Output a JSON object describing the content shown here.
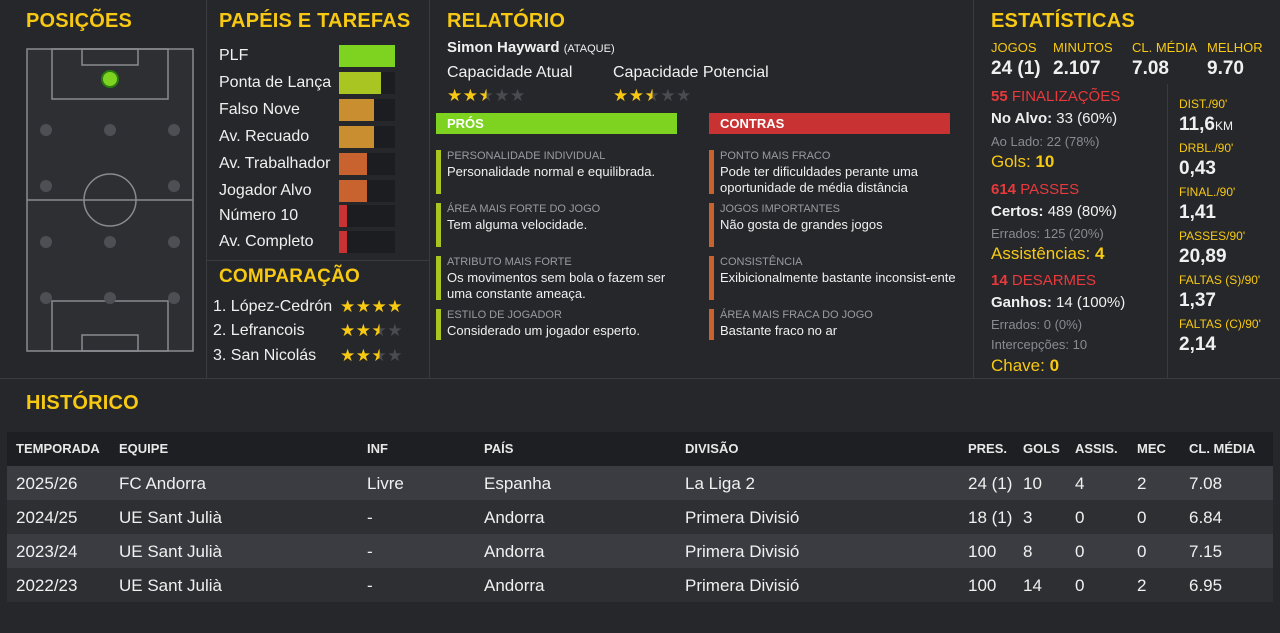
{
  "positions": {
    "title": "POSIÇÕES"
  },
  "roles": {
    "title": "PAPÉIS E TAREFAS",
    "items": [
      {
        "label": "PLF",
        "rating": 1.0,
        "color": "#7ed321"
      },
      {
        "label": "Ponta de Lança",
        "rating": 0.75,
        "color": "#a9c522"
      },
      {
        "label": "Falso Nove",
        "rating": 0.62,
        "color": "#c88e2f"
      },
      {
        "label": "Av. Recuado",
        "rating": 0.62,
        "color": "#c88e2f"
      },
      {
        "label": "Av. Trabalhador",
        "rating": 0.5,
        "color": "#c8622f"
      },
      {
        "label": "Jogador Alvo",
        "rating": 0.5,
        "color": "#c8622f"
      },
      {
        "label": "Número 10",
        "rating": 0.14,
        "color": "#c83232"
      },
      {
        "label": "Av. Completo",
        "rating": 0.14,
        "color": "#c83232"
      }
    ]
  },
  "comparison": {
    "title": "COMPARAÇÃO",
    "items": [
      {
        "label": "1. López-Cedrón",
        "stars": 4,
        "max": 4
      },
      {
        "label": "2. Lefrancois",
        "stars": 2.5,
        "max": 4
      },
      {
        "label": "3. San Nicolás",
        "stars": 2.5,
        "max": 4
      }
    ]
  },
  "report": {
    "title": "RELATÓRIO",
    "player_name": "Simon Hayward",
    "player_tag": "(ATAQUE)",
    "current_ability_label": "Capacidade Atual",
    "current_ability_stars": 2.5,
    "potential_ability_label": "Capacidade Potencial",
    "potential_ability_stars": 2.5,
    "pros_header": "PRÓS",
    "cons_header": "CONTRAS",
    "pros": [
      {
        "caption": "PERSONALIDADE INDIVIDUAL",
        "text": "Personalidade normal e equilibrada."
      },
      {
        "caption": "ÁREA MAIS FORTE DO JOGO",
        "text": "Tem alguma velocidade."
      },
      {
        "caption": "ATRIBUTO MAIS FORTE",
        "text": "Os movimentos sem bola o fazem ser uma constante ameaça."
      },
      {
        "caption": "ESTILO DE JOGADOR",
        "text": "Considerado um jogador esperto."
      }
    ],
    "cons": [
      {
        "caption": "PONTO MAIS FRACO",
        "text": "Pode ter dificuldades perante uma oportunidade de média distância"
      },
      {
        "caption": "JOGOS IMPORTANTES",
        "text": "Não gosta de grandes jogos"
      },
      {
        "caption": "CONSISTÊNCIA",
        "text": "Exibicionalmente bastante inconsist-ente"
      },
      {
        "caption": "ÁREA MAIS FRACA DO JOGO",
        "text": "Bastante fraco no ar"
      }
    ],
    "colors": {
      "pros": "#7ed321",
      "cons": "#c83232",
      "pros_mark": "#a9c522",
      "cons_mark": "#c8622f"
    }
  },
  "stats": {
    "title": "ESTATÍSTICAS",
    "headline": [
      {
        "label": "JOGOS",
        "value": "24 (1)"
      },
      {
        "label": "MINUTOS",
        "value": "2.107"
      },
      {
        "label": "CL. MÉDIA",
        "value": "7.08"
      },
      {
        "label": "MELHOR",
        "value": "9.70"
      }
    ],
    "shots": {
      "count": "55",
      "label": "FINALIZAÇÕES",
      "on_target_label": "No Alvo:",
      "on_target_value": "33 (60%)",
      "off_target": "Ao Lado: 22 (78%)",
      "goals_label": "Gols:",
      "goals_value": "10"
    },
    "passes": {
      "count": "614",
      "label": "PASSES",
      "completed_label": "Certos:",
      "completed_value": "489 (80%)",
      "missed": "Errados: 125 (20%)",
      "assists_label": "Assistências:",
      "assists_value": "4"
    },
    "tackles": {
      "count": "14",
      "label": "DESARMES",
      "won_label": "Ganhos:",
      "won_value": "14 (100%)",
      "missed": "Errados: 0 (0%)",
      "interceptions": "Intercepções: 10",
      "key_label": "Chave:",
      "key_value": "0"
    },
    "per90": [
      {
        "label": "DIST./90'",
        "value": "11,6",
        "unit": "KM"
      },
      {
        "label": "DRBL./90'",
        "value": "0,43",
        "unit": ""
      },
      {
        "label": "FINAL./90'",
        "value": "1,41",
        "unit": ""
      },
      {
        "label": "PASSES/90'",
        "value": "20,89",
        "unit": ""
      },
      {
        "label": "FALTAS (S)/90'",
        "value": "1,37",
        "unit": ""
      },
      {
        "label": "FALTAS (C)/90'",
        "value": "2,14",
        "unit": ""
      }
    ]
  },
  "history": {
    "title": "HISTÓRICO",
    "columns": [
      "TEMPORADA",
      "EQUIPE",
      "INF",
      "PAÍS",
      "DIVISÃO",
      "PRES.",
      "GOLS",
      "ASSIS.",
      "MEC",
      "CL. MÉDIA"
    ],
    "rows": [
      [
        "2025/26",
        "FC Andorra",
        "Livre",
        "Espanha",
        "La Liga 2",
        "24 (1)",
        "10",
        "4",
        "2",
        "7.08"
      ],
      [
        "2024/25",
        "UE Sant Julià",
        "-",
        "Andorra",
        "Primera Divisió",
        "18 (1)",
        "3",
        "0",
        "0",
        "6.84"
      ],
      [
        "2023/24",
        "UE Sant Julià",
        "-",
        "Andorra",
        "Primera Divisió",
        "100",
        "8",
        "0",
        "0",
        "7.15"
      ],
      [
        "2022/23",
        "UE Sant Julià",
        "-",
        "Andorra",
        "Primera Divisió",
        "100",
        "14",
        "0",
        "2",
        "6.95"
      ]
    ]
  }
}
